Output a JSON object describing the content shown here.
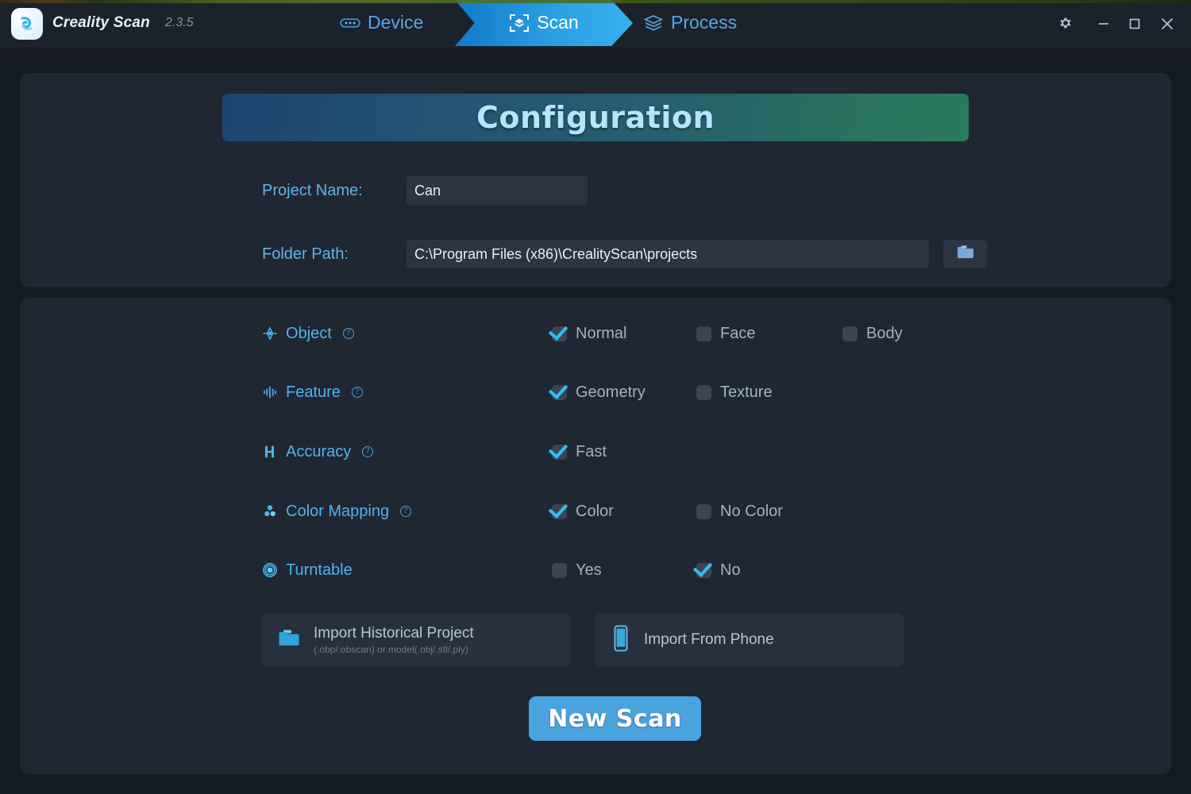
{
  "app": {
    "name": "Creality Scan",
    "version": "2.3.5",
    "logo_icon": "creality-swirl-logo"
  },
  "nav": {
    "tabs": [
      {
        "id": "device",
        "label": "Device",
        "icon": "device-pill-icon",
        "active": false
      },
      {
        "id": "scan",
        "label": "Scan",
        "icon": "scan-target-icon",
        "active": true
      },
      {
        "id": "process",
        "label": "Process",
        "icon": "layers-stack-icon",
        "active": false
      }
    ]
  },
  "window_controls": {
    "settings": "gear-icon",
    "minimize": "minimize-icon",
    "maximize": "maximize-icon",
    "close": "close-icon"
  },
  "config": {
    "banner_title": "Configuration",
    "project_name": {
      "label": "Project Name:",
      "value": "Can",
      "placeholder": "Project Name"
    },
    "folder_path": {
      "label": "Folder Path:",
      "value": "C:\\Program Files (x86)\\CrealityScan\\projects",
      "placeholder": "Folder Path",
      "browse_icon": "folder-icon"
    }
  },
  "options": [
    {
      "id": "object",
      "label": "Object",
      "icon": "target-diamond-icon",
      "has_help": true,
      "choices": [
        {
          "label": "Normal",
          "checked": true
        },
        {
          "label": "Face",
          "checked": false
        },
        {
          "label": "Body",
          "checked": false
        }
      ]
    },
    {
      "id": "feature",
      "label": "Feature",
      "icon": "waveform-icon",
      "has_help": true,
      "choices": [
        {
          "label": "Geometry",
          "checked": true
        },
        {
          "label": "Texture",
          "checked": false
        }
      ]
    },
    {
      "id": "accuracy",
      "label": "Accuracy",
      "icon": "letter-h-icon",
      "has_help": true,
      "choices": [
        {
          "label": "Fast",
          "checked": true
        }
      ]
    },
    {
      "id": "color-mapping",
      "label": "Color Mapping",
      "icon": "color-nodes-icon",
      "has_help": true,
      "choices": [
        {
          "label": "Color",
          "checked": true
        },
        {
          "label": "No Color",
          "checked": false
        }
      ]
    },
    {
      "id": "turntable",
      "label": "Turntable",
      "icon": "concentric-circle-icon",
      "has_help": false,
      "choices": [
        {
          "label": "Yes",
          "checked": false
        },
        {
          "label": "No",
          "checked": true
        }
      ]
    }
  ],
  "actions": {
    "import_historical": {
      "title": "Import Historical Project",
      "subtitle": "(.obp/.obscan) or model(.obj/.stl/.ply)",
      "icon": "folder-open-icon"
    },
    "import_phone": {
      "title": "Import From Phone",
      "icon": "phone-icon"
    },
    "new_scan": {
      "label": "New Scan"
    }
  },
  "colors": {
    "page_background": "#141a21",
    "panel_background": "#1f2732",
    "titlebar_background": "#1b222b",
    "accent_blue": "#4eb3ee",
    "accent_cyan": "#2ec0f2",
    "active_tab_blue": "#2a9fe3",
    "primary_button": "#4aa3dd",
    "banner_gradient_start": "#1d4470",
    "banner_gradient_end": "#2b7a5d",
    "label_text": "#9eb2c6"
  }
}
